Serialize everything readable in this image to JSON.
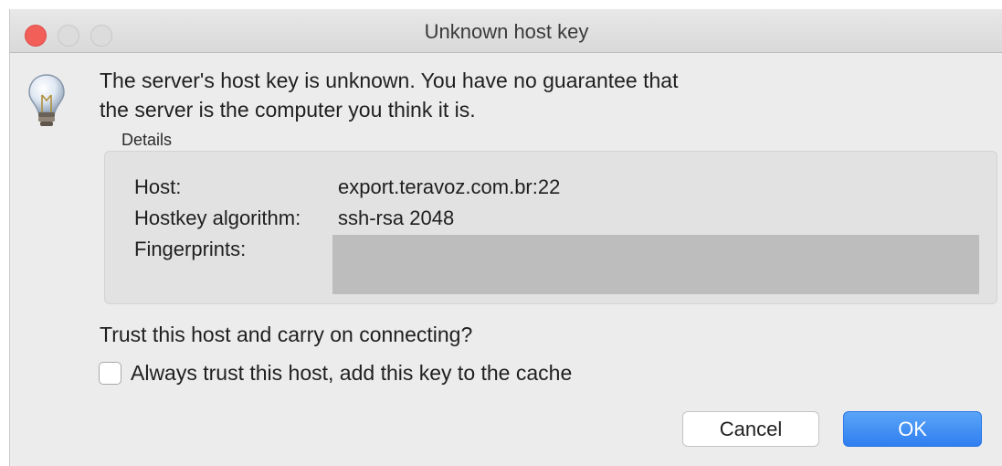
{
  "window": {
    "title": "Unknown host key"
  },
  "message": {
    "line1": "The server's host key is unknown. You have no guarantee that",
    "line2": "the server is the computer you think it is."
  },
  "details": {
    "label": "Details",
    "rows": [
      {
        "label": "Host:",
        "value": "export.teravoz.com.br:22"
      },
      {
        "label": "Hostkey algorithm:",
        "value": "ssh-rsa 2048"
      },
      {
        "label": "Fingerprints:",
        "value": ""
      }
    ]
  },
  "question": "Trust this host and carry on connecting?",
  "checkbox": {
    "label": "Always trust this host, add this key to the cache",
    "checked": false
  },
  "buttons": {
    "cancel": "Cancel",
    "ok": "OK"
  },
  "colors": {
    "close": "#f25f58",
    "ok": "#2f7ef0"
  },
  "icons": {
    "message": "lightbulb-icon"
  }
}
